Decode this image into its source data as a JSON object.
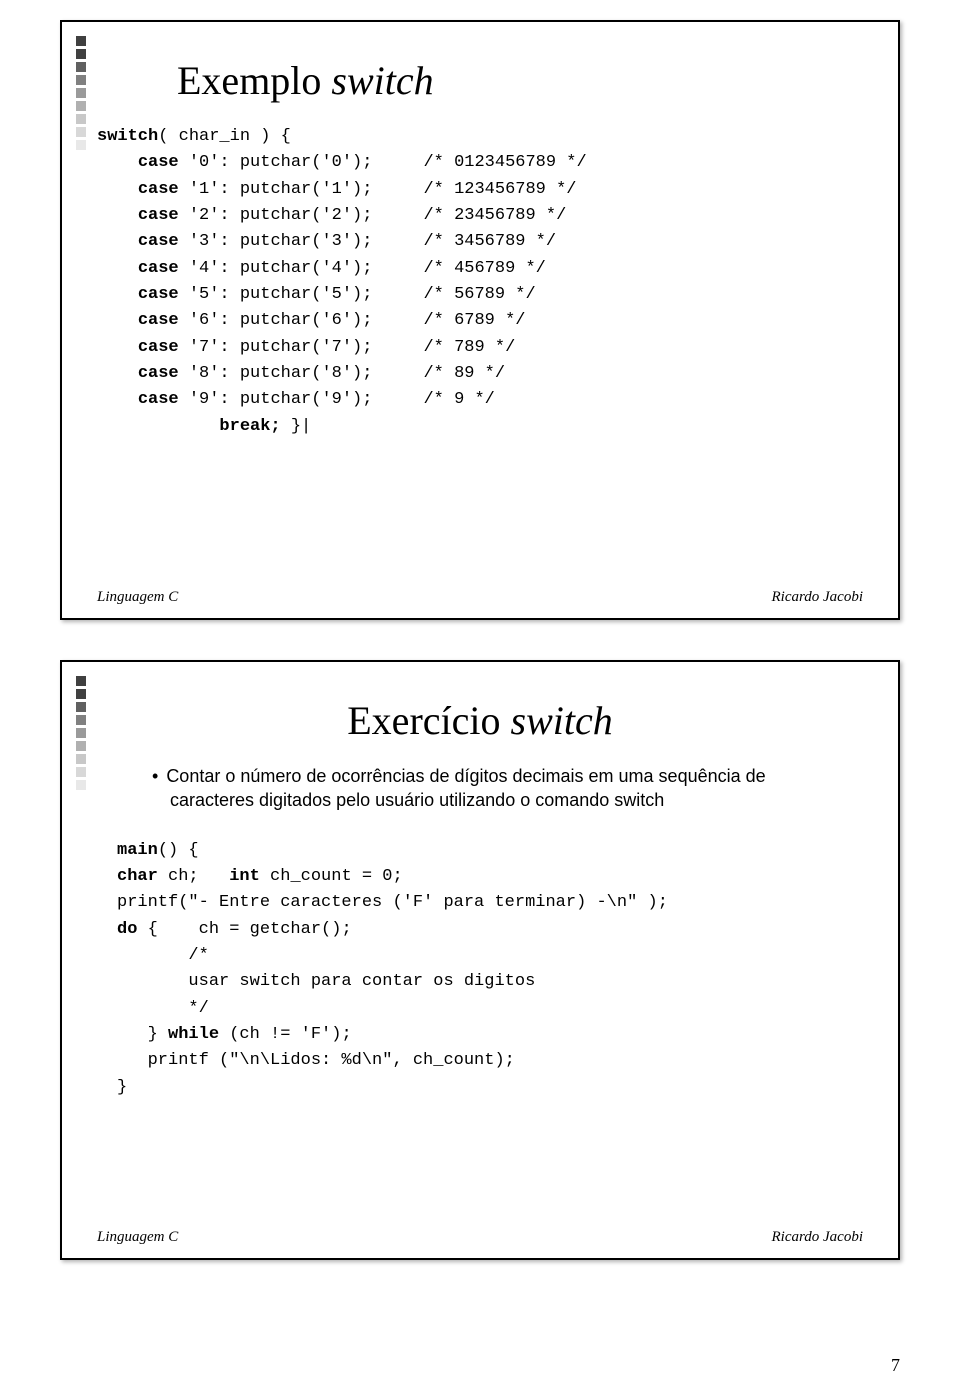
{
  "slide1": {
    "title_plain": "Exemplo ",
    "title_italic": "switch",
    "code": {
      "l0_kw": "switch",
      "l0_rest": "( char_in ) {",
      "rows": [
        {
          "kw": "case",
          "lab": " '0': putchar('0');",
          "cm": "/* 0123456789 */"
        },
        {
          "kw": "case",
          "lab": " '1': putchar('1');",
          "cm": "/* 123456789 */"
        },
        {
          "kw": "case",
          "lab": " '2': putchar('2');",
          "cm": "/* 23456789 */"
        },
        {
          "kw": "case",
          "lab": " '3': putchar('3');",
          "cm": "/* 3456789 */"
        },
        {
          "kw": "case",
          "lab": " '4': putchar('4');",
          "cm": "/* 456789 */"
        },
        {
          "kw": "case",
          "lab": " '5': putchar('5');",
          "cm": "/* 56789 */"
        },
        {
          "kw": "case",
          "lab": " '6': putchar('6');",
          "cm": "/* 6789 */"
        },
        {
          "kw": "case",
          "lab": " '7': putchar('7');",
          "cm": "/* 789 */"
        },
        {
          "kw": "case",
          "lab": " '8': putchar('8');",
          "cm": "/* 89 */"
        },
        {
          "kw": "case",
          "lab": " '9': putchar('9');",
          "cm": "/* 9 */"
        }
      ],
      "break_kw": "break;",
      "break_rest": " }|"
    },
    "footer_left": "Linguagem C",
    "footer_right": "Ricardo Jacobi"
  },
  "slide2": {
    "title_plain": "Exercício ",
    "title_italic": "switch",
    "bullet_dot": "•",
    "bullet_text": "Contar o número de ocorrências de dígitos decimais em uma sequência de caracteres digitados pelo usuário utilizando o comando switch",
    "code": {
      "l0_kw": "main",
      "l0_rest": "() {",
      "l1_kw": "char",
      "l1_mid": " ch;   ",
      "l1_kw2": "int",
      "l1_rest": " ch_count = 0;",
      "l2": "printf(\"- Entre caracteres ('F' para terminar) -\\n\" );",
      "l3_kw": "do",
      "l3_rest": " {    ch = getchar();",
      "l4": "       /*",
      "l5": "       usar switch para contar os digitos",
      "l6": "       */",
      "l7_pre": "   } ",
      "l7_kw": "while",
      "l7_rest": " (ch != 'F');",
      "l8": "   printf (\"\\n\\Lidos: %d\\n\", ch_count);",
      "l9": "}"
    },
    "footer_left": "Linguagem C",
    "footer_right": "Ricardo Jacobi"
  },
  "page_number": "7"
}
